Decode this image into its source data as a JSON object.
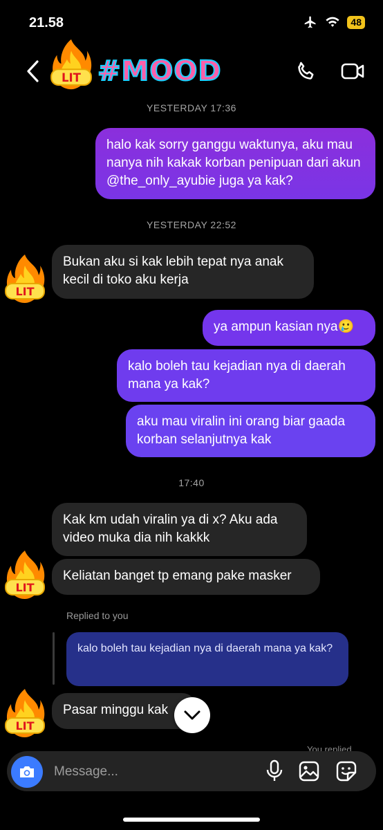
{
  "status_bar": {
    "time": "21.58",
    "battery": "48"
  },
  "header": {
    "title": "#MOOD",
    "avatar_text": "LIT"
  },
  "messages": {
    "stamp1": "YESTERDAY 17:36",
    "m1": "halo kak sorry ganggu waktunya, aku mau nanya nih kakak korban penipuan dari akun @the_only_ayubie juga ya kak?",
    "stamp2": "YESTERDAY 22:52",
    "m2": "Bukan aku si kak lebih tepat nya anak kecil di toko aku kerja",
    "m3": "ya ampun kasian nya🥲",
    "m4": "kalo boleh tau kejadian nya di daerah mana ya kak?",
    "m5": "aku mau viralin ini orang biar gaada korban selanjutnya kak",
    "stamp3": "17:40",
    "m6": "Kak km udah viralin ya di x? Aku ada video muka dia nih kakkk",
    "m7": "Keliatan banget tp emang pake masker",
    "replied_label": "Replied to you",
    "reply_quote": "kalo boleh tau kejadian nya di daerah mana ya kak?",
    "m8": "Pasar minggu kak",
    "you_replied": "You replied"
  },
  "composer": {
    "placeholder": "Message..."
  },
  "colors": {
    "outgoing": "#6d3cf0",
    "incoming": "#262626",
    "accent": "#3b7bff",
    "title_fill": "#ff5fa8",
    "title_stroke": "#1ad0ff"
  },
  "icons": [
    "back-chevron-icon",
    "fire-lit-icon",
    "phone-icon",
    "video-camera-icon",
    "chevron-down-icon",
    "camera-icon",
    "microphone-icon",
    "gallery-icon",
    "sticker-icon",
    "airplane-icon",
    "wifi-icon"
  ]
}
